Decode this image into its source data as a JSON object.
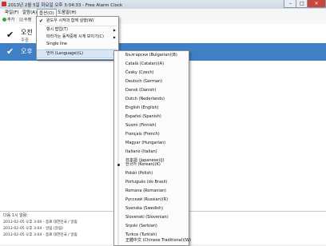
{
  "window": {
    "title": "2013년 2월 5일 화요일 오후 3:04:33 - Free Alarm Clock",
    "controls": [
      "–",
      "□",
      "✕"
    ]
  },
  "menubar": {
    "items": [
      "파일(F)",
      "알람(A)",
      "옵션(O)",
      "도움말(H)"
    ]
  },
  "toolbar": {
    "add": "추가",
    "edit": "수정"
  },
  "alarms": [
    {
      "check": "✔",
      "name": "오전",
      "sub": "주중"
    },
    {
      "check": "✔",
      "name": "오후",
      "sub": ""
    }
  ],
  "options_menu": {
    "items": [
      {
        "label": "윈도우 시작과 함께 실행(W)",
        "checked": true
      },
      {
        "label": "항시 팝업(T)",
        "submenu": true
      },
      {
        "label": "따라가는 동작중에 시계 보이기(C)",
        "submenu": true
      },
      {
        "label": "Single line"
      },
      {
        "label": "언어 (Language)(L)",
        "submenu": true,
        "hover": true
      }
    ]
  },
  "languages": [
    "Български (Bulgarian)(B)",
    "Català (Catalan)(A)",
    "Česky (Czech)",
    "Deutsch (German)",
    "Dansk (Danish)",
    "Dutch (Nederlands)",
    "English (English)",
    "Español (Spanish)",
    "Suomi (Finnish)",
    "Français (French)",
    "Magyar (Hungarian)",
    "Italiano (Italian)",
    "日本語 (Japanese)(J)",
    "한국어 (Korean)(K)",
    "Polski (Polish)",
    "Português (do Brasil)",
    "Romana (Romanian)",
    "Русский (Russian)(R)",
    "Svenska (Swedish)",
    "Slovenski (Slovenian)",
    "Srpski (Serbian)",
    "Turkce (Turkish)",
    "正體中文 (Chinese Traditional)(W)"
  ],
  "selected_language_index": 13,
  "status": {
    "header": "다음 1시 알람:",
    "log": [
      "2013-02-05 오후 3:00 - 종료 대한민국 / 알림",
      "2013-02-05 오후 3:04 - 알림 (알림)",
      "2013-02-05 오후 3:04 - 종료 대한민국 / 알림"
    ]
  },
  "colors": {
    "selection": "#3f7fc6",
    "hover": "#d9e6f6"
  }
}
